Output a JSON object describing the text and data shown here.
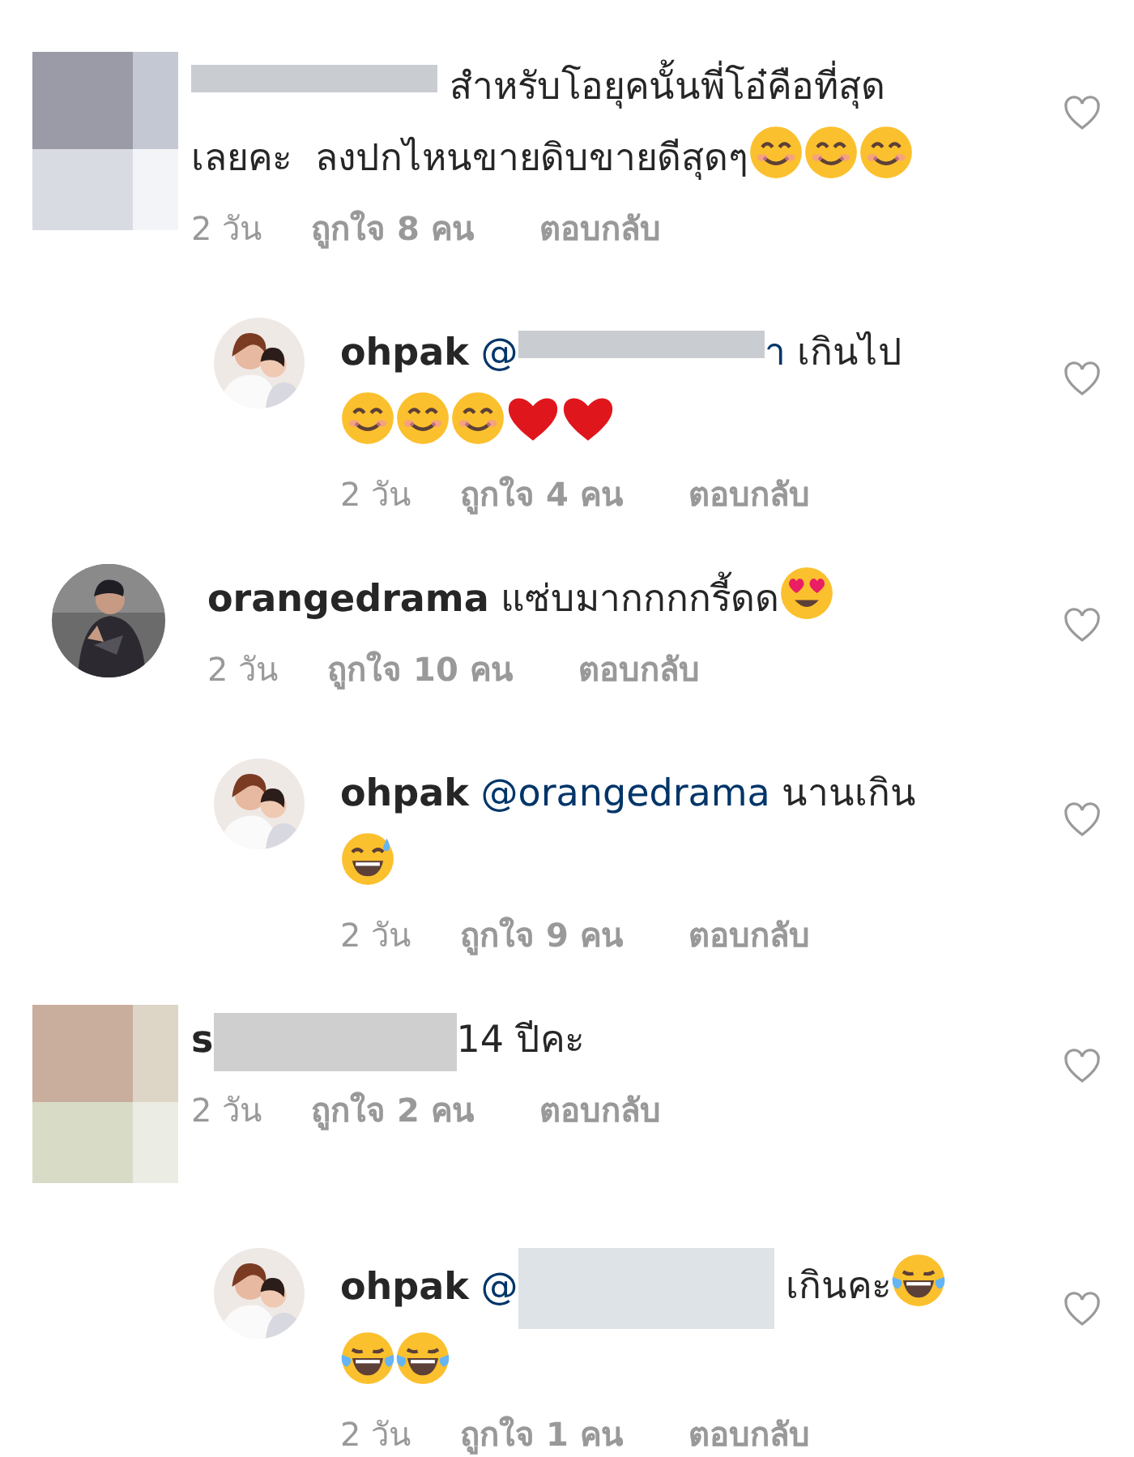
{
  "comments": [
    {
      "kind": "top",
      "avatar": {
        "kind": "mosaic"
      },
      "body": [
        {
          "kind": "strip"
        },
        {
          "kind": "text",
          "text": " สำหรับโอยุคนั้นพี่โอ๋คือที่สุด"
        },
        {
          "kind": "text",
          "text": "เลยคะ  ลงปกไหนขายดิบขายดีสุดๆ"
        },
        {
          "kind": "smile"
        },
        {
          "kind": "smile"
        },
        {
          "kind": "smile"
        }
      ],
      "time": "2 วัน",
      "likes": "ถูกใจ 8 คน",
      "reply": "ตอบกลับ"
    },
    {
      "kind": "reply",
      "avatar": {
        "kind": "picture"
      },
      "body": [
        {
          "kind": "user",
          "text": "ohpak"
        },
        {
          "kind": "mention",
          "text": " @"
        },
        {
          "kind": "strip"
        },
        {
          "kind": "mention",
          "text": "า"
        },
        {
          "kind": "text",
          "text": " เกินไป"
        },
        {
          "kind": "smile"
        },
        {
          "kind": "smile"
        },
        {
          "kind": "smile"
        },
        {
          "kind": "heart"
        },
        {
          "kind": "heart"
        }
      ],
      "time": "2 วัน",
      "likes": "ถูกใจ 4 คน",
      "reply": "ตอบกลับ"
    },
    {
      "kind": "top",
      "avatar": {
        "kind": "picture"
      },
      "body": [
        {
          "kind": "user",
          "text": "orangedrama"
        },
        {
          "kind": "text",
          "text": " แซ่บมากกกกรี้ดด"
        },
        {
          "kind": "hearteyes"
        }
      ],
      "time": "2 วัน",
      "likes": "ถูกใจ 10 คน",
      "reply": "ตอบกลับ"
    },
    {
      "kind": "reply",
      "avatar": {
        "kind": "picture"
      },
      "body": [
        {
          "kind": "user",
          "text": "ohpak"
        },
        {
          "kind": "mention",
          "text": " @orangedrama"
        },
        {
          "kind": "text",
          "text": " นานเกิน"
        },
        {
          "kind": "sweat"
        }
      ],
      "time": "2 วัน",
      "likes": "ถูกใจ 9 คน",
      "reply": "ตอบกลับ"
    },
    {
      "kind": "top",
      "avatar": {
        "kind": "mosaic"
      },
      "body": [
        {
          "kind": "user",
          "text": "s"
        },
        {
          "kind": "block"
        },
        {
          "kind": "text",
          "text": "14 ปีคะ"
        }
      ],
      "time": "2 วัน",
      "likes": "ถูกใจ 2 คน",
      "reply": "ตอบกลับ"
    },
    {
      "kind": "reply",
      "avatar": {
        "kind": "picture"
      },
      "body": [
        {
          "kind": "user",
          "text": "ohpak"
        },
        {
          "kind": "mention",
          "text": " @"
        },
        {
          "kind": "panel"
        },
        {
          "kind": "text",
          "text": " เกินคะ"
        },
        {
          "kind": "joy"
        },
        {
          "kind": "joy"
        },
        {
          "kind": "joy"
        }
      ],
      "time": "2 วัน",
      "likes": "ถูกใจ 1 คน",
      "reply": "ตอบกลับ"
    }
  ]
}
